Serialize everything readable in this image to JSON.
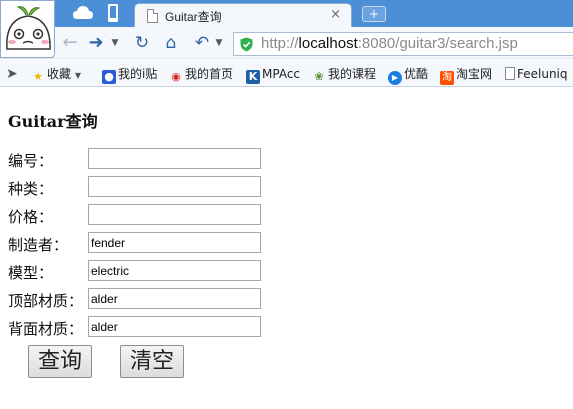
{
  "browser": {
    "tab_title": "Guitar查询",
    "tab_close": "×",
    "new_tab": "+",
    "url_prefix": "http://",
    "url_host": "localhost",
    "url_rest": ":8080/guitar3/search.jsp",
    "bookmarks": [
      {
        "label": "收藏",
        "icon": "star-icon"
      },
      {
        "label": "我的i贴",
        "icon": "paw-icon"
      },
      {
        "label": "我的首页",
        "icon": "weibo-icon"
      },
      {
        "label": "MPAcc",
        "icon": "k-icon"
      },
      {
        "label": "我的课程",
        "icon": "leaf-icon"
      },
      {
        "label": "优酷",
        "icon": "play-icon"
      },
      {
        "label": "淘宝网",
        "icon": "taobao-icon"
      },
      {
        "label": "Feeluniq",
        "icon": "page-icon"
      }
    ]
  },
  "page": {
    "title": "Guitar查询",
    "fields": [
      {
        "label": "编号：",
        "value": ""
      },
      {
        "label": "种类：",
        "value": ""
      },
      {
        "label": "价格：",
        "value": ""
      },
      {
        "label": "制造者：",
        "value": "fender"
      },
      {
        "label": "模型：",
        "value": "electric"
      },
      {
        "label": "顶部材质：",
        "value": "alder"
      },
      {
        "label": "背面材质：",
        "value": "alder"
      }
    ],
    "buttons": {
      "query": "查询",
      "clear": "清空"
    }
  },
  "colors": {
    "titlebar": "#4d8fd6",
    "toolbar": "#f4f7fb",
    "link_blue": "#2d66a8"
  }
}
